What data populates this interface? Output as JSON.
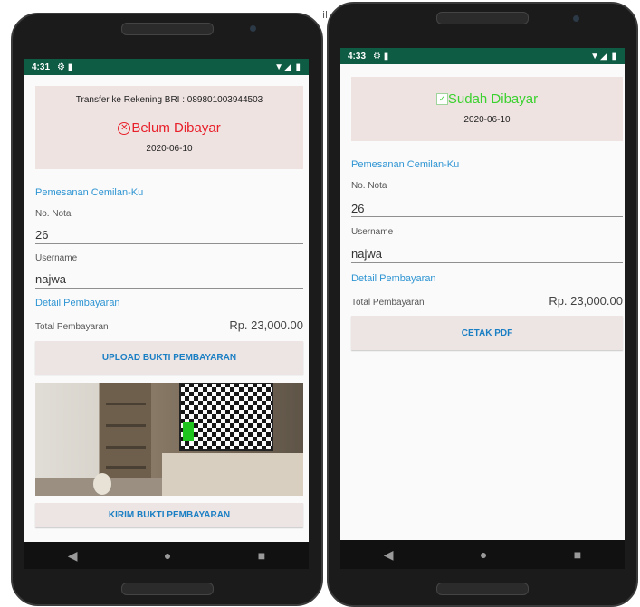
{
  "stray_text": "il",
  "left": {
    "status": {
      "time": "4:31",
      "icons": "⚙ ▮",
      "right": "▼◢ ▮"
    },
    "header": {
      "transfer_text": "Transfer ke Rekening BRI : 089801003944503",
      "status_text": "Belum Dibayar",
      "status_color": "#e8202a",
      "date": "2020-06-10"
    },
    "section_title": "Pemesanan Cemilan-Ku",
    "nota_label": "No. Nota",
    "nota_value": "26",
    "username_label": "Username",
    "username_value": "najwa",
    "detail_title": "Detail Pembayaran",
    "total_label": "Total Pembayaran",
    "total_value": "Rp. 23,000.00",
    "upload_button": "UPLOAD BUKTI PEMBAYARAN",
    "send_button": "KIRIM BUKTI PEMBAYARAN"
  },
  "right": {
    "status": {
      "time": "4:33",
      "icons": "⚙ ▮",
      "right": "▼◢ ▮"
    },
    "header": {
      "status_text": "Sudah Dibayar",
      "status_color": "#3bd12f",
      "date": "2020-06-10"
    },
    "section_title": "Pemesanan Cemilan-Ku",
    "nota_label": "No. Nota",
    "nota_value": "26",
    "username_label": "Username",
    "username_value": "najwa",
    "detail_title": "Detail Pembayaran",
    "total_label": "Total Pembayaran",
    "total_value": "Rp. 23,000.00",
    "print_button": "CETAK PDF"
  },
  "nav": {
    "back": "◀",
    "home": "●",
    "recents": "■"
  }
}
